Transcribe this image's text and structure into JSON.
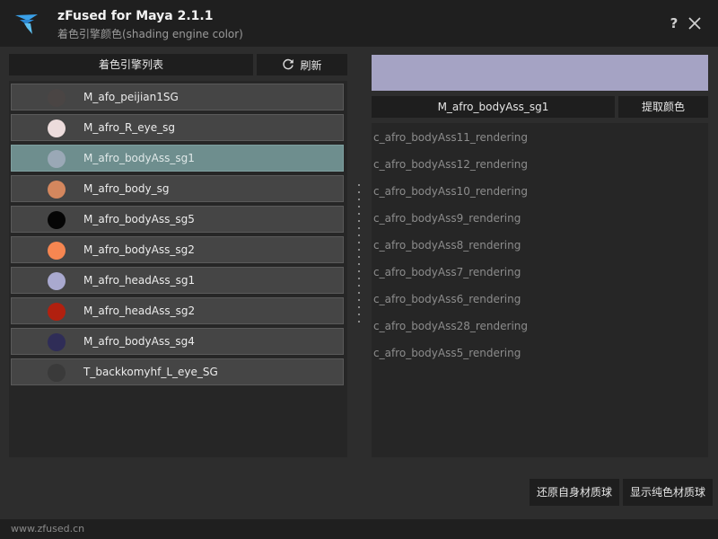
{
  "app": {
    "title": "zFused for Maya 2.1.1",
    "subtitle": "着色引擎颜色(shading engine color)",
    "help_label": "?",
    "logo_icon": "zfused-logo-icon",
    "close_icon": "close-icon"
  },
  "left": {
    "header_label": "着色引擎列表",
    "refresh_label": "刷新",
    "refresh_icon": "refresh-icon",
    "items": [
      {
        "label": "M_afo_peijian1SG",
        "color": "#4a4544",
        "selected": false
      },
      {
        "label": "M_afro_R_eye_sg",
        "color": "#ecdcdc",
        "selected": false
      },
      {
        "label": "M_afro_bodyAss_sg1",
        "color": "#9aa8b6",
        "selected": true
      },
      {
        "label": "M_afro_body_sg",
        "color": "#d4875e",
        "selected": false
      },
      {
        "label": "M_afro_bodyAss_sg5",
        "color": "#050505",
        "selected": false
      },
      {
        "label": "M_afro_bodyAss_sg2",
        "color": "#f68651",
        "selected": false
      },
      {
        "label": "M_afro_headAss_sg1",
        "color": "#a9a9cf",
        "selected": false
      },
      {
        "label": "M_afro_headAss_sg2",
        "color": "#b1200f",
        "selected": false
      },
      {
        "label": "M_afro_bodyAss_sg4",
        "color": "#2f2d57",
        "selected": false
      },
      {
        "label": "T_backkomyhf_L_eye_SG",
        "color": "#3a3a3a",
        "selected": false
      }
    ]
  },
  "right": {
    "preview_color": "#a5a3c4",
    "selected_name": "M_afro_bodyAss_sg1",
    "pick_color_label": "提取颜色",
    "objects": [
      "c_afro_bodyAss11_rendering",
      "c_afro_bodyAss12_rendering",
      "c_afro_bodyAss10_rendering",
      "c_afro_bodyAss9_rendering",
      "c_afro_bodyAss8_rendering",
      "c_afro_bodyAss7_rendering",
      "c_afro_bodyAss6_rendering",
      "c_afro_bodyAss28_rendering",
      "c_afro_bodyAss5_rendering"
    ]
  },
  "buttons": {
    "restore_label": "还原自身材质球",
    "show_label": "显示纯色材质球"
  },
  "footer": {
    "text": "www.zfused.cn"
  }
}
